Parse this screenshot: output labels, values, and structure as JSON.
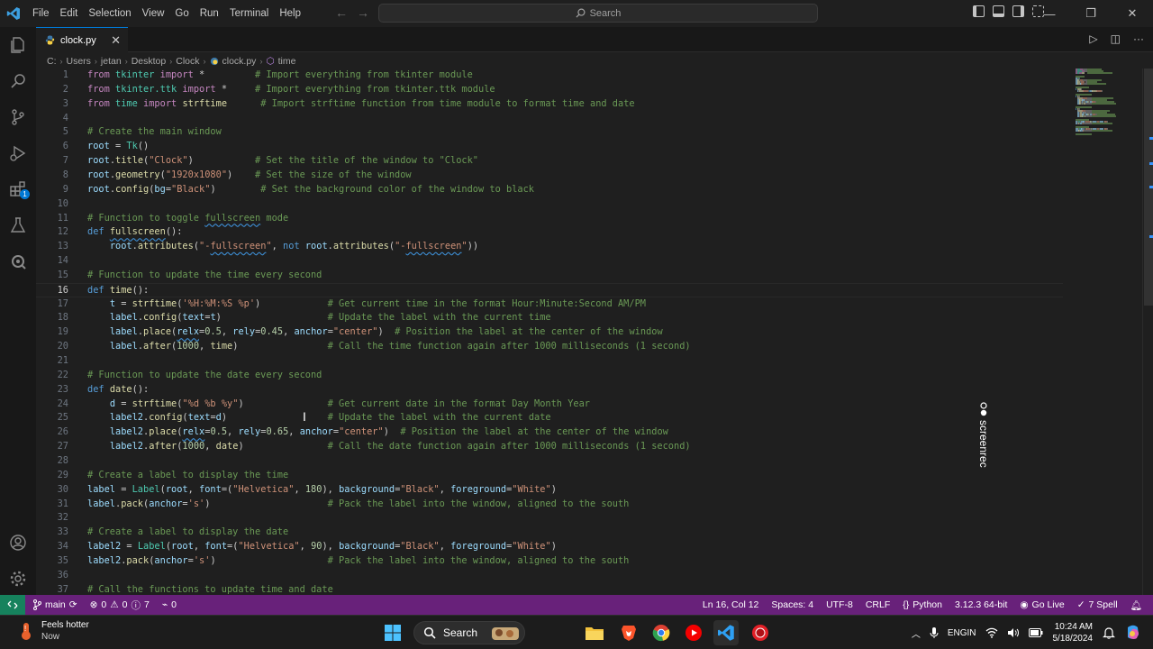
{
  "menu": [
    "File",
    "Edit",
    "Selection",
    "View",
    "Go",
    "Run",
    "Terminal",
    "Help"
  ],
  "search": {
    "placeholder": "Search"
  },
  "tab": {
    "name": "clock.py"
  },
  "breadcrumb": [
    "C:",
    "Users",
    "jetan",
    "Desktop",
    "Clock",
    "clock.py",
    "time"
  ],
  "editor": {
    "active_line": 16,
    "lines": [
      [
        [
          "kw2",
          "from"
        ],
        [
          "",
          " "
        ],
        [
          "cls",
          "tkinter"
        ],
        [
          "",
          " "
        ],
        [
          "kw2",
          "import"
        ],
        [
          "",
          " *         "
        ],
        [
          "cm",
          "# Import everything from tkinter module"
        ]
      ],
      [
        [
          "kw2",
          "from"
        ],
        [
          "",
          " "
        ],
        [
          "cls",
          "tkinter.ttk"
        ],
        [
          "",
          " "
        ],
        [
          "kw2",
          "import"
        ],
        [
          "",
          " *     "
        ],
        [
          "cm",
          "# Import everything from tkinter.ttk module"
        ]
      ],
      [
        [
          "kw2",
          "from"
        ],
        [
          "",
          " "
        ],
        [
          "cls",
          "time"
        ],
        [
          "",
          " "
        ],
        [
          "kw2",
          "import"
        ],
        [
          "",
          " "
        ],
        [
          "fn",
          "strftime"
        ],
        [
          "",
          "      "
        ],
        [
          "cm",
          "# Import strftime function from time module to format time and date"
        ]
      ],
      [],
      [
        [
          "cm",
          "# Create the main window"
        ]
      ],
      [
        [
          "var",
          "root"
        ],
        [
          "",
          " = "
        ],
        [
          "cls",
          "Tk"
        ],
        [
          "",
          "()"
        ]
      ],
      [
        [
          "var",
          "root"
        ],
        [
          "",
          "."
        ],
        [
          "fn",
          "title"
        ],
        [
          "",
          "("
        ],
        [
          "str",
          "\"Clock\""
        ],
        [
          "",
          ")           "
        ],
        [
          "cm",
          "# Set the title of the window to \"Clock\""
        ]
      ],
      [
        [
          "var",
          "root"
        ],
        [
          "",
          "."
        ],
        [
          "fn",
          "geometry"
        ],
        [
          "",
          "("
        ],
        [
          "str",
          "\"1920x1080\""
        ],
        [
          "",
          ")    "
        ],
        [
          "cm",
          "# Set the size of the window"
        ]
      ],
      [
        [
          "var",
          "root"
        ],
        [
          "",
          "."
        ],
        [
          "fn",
          "config"
        ],
        [
          "",
          "("
        ],
        [
          "var",
          "bg"
        ],
        [
          "",
          "="
        ],
        [
          "str",
          "\"Black\""
        ],
        [
          "",
          ")        "
        ],
        [
          "cm",
          "# Set the background color of the window to black"
        ]
      ],
      [],
      [
        [
          "cm",
          "# Function to toggle "
        ],
        [
          "cm sq",
          "fullscreen"
        ],
        [
          "cm",
          " mode"
        ]
      ],
      [
        [
          "kw",
          "def"
        ],
        [
          "",
          " "
        ],
        [
          "fn sq",
          "fullscreen"
        ],
        [
          "",
          "():"
        ]
      ],
      [
        [
          "",
          "    "
        ],
        [
          "var",
          "root"
        ],
        [
          "",
          "."
        ],
        [
          "fn",
          "attributes"
        ],
        [
          "",
          "("
        ],
        [
          "str",
          "\"-"
        ],
        [
          "str sq",
          "fullscreen"
        ],
        [
          "str",
          "\""
        ],
        [
          "",
          ", "
        ],
        [
          "kw",
          "not"
        ],
        [
          "",
          " "
        ],
        [
          "var",
          "root"
        ],
        [
          "",
          "."
        ],
        [
          "fn",
          "attributes"
        ],
        [
          "",
          "("
        ],
        [
          "str",
          "\"-"
        ],
        [
          "str sq",
          "fullscreen"
        ],
        [
          "str",
          "\""
        ],
        [
          "",
          "))"
        ]
      ],
      [],
      [
        [
          "cm",
          "# Function to update the time every second"
        ]
      ],
      [
        [
          "kw",
          "def"
        ],
        [
          "",
          " "
        ],
        [
          "fn",
          "time"
        ],
        [
          "",
          "():"
        ]
      ],
      [
        [
          "",
          "    "
        ],
        [
          "var",
          "t"
        ],
        [
          "",
          " = "
        ],
        [
          "fn",
          "strftime"
        ],
        [
          "",
          "("
        ],
        [
          "str",
          "'%H:%M:%S %p'"
        ],
        [
          "",
          ")            "
        ],
        [
          "cm",
          "# Get current time in the format Hour:Minute:Second AM/PM"
        ]
      ],
      [
        [
          "",
          "    "
        ],
        [
          "var",
          "label"
        ],
        [
          "",
          "."
        ],
        [
          "fn",
          "config"
        ],
        [
          "",
          "("
        ],
        [
          "var",
          "text"
        ],
        [
          "",
          "="
        ],
        [
          "var",
          "t"
        ],
        [
          "",
          ")                   "
        ],
        [
          "cm",
          "# Update the label with the current time"
        ]
      ],
      [
        [
          "",
          "    "
        ],
        [
          "var",
          "label"
        ],
        [
          "",
          "."
        ],
        [
          "fn",
          "place"
        ],
        [
          "",
          "("
        ],
        [
          "var sq",
          "relx"
        ],
        [
          "",
          "="
        ],
        [
          "num",
          "0.5"
        ],
        [
          "",
          ", "
        ],
        [
          "var",
          "rely"
        ],
        [
          "",
          "="
        ],
        [
          "num",
          "0.45"
        ],
        [
          "",
          ", "
        ],
        [
          "var",
          "anchor"
        ],
        [
          "",
          "="
        ],
        [
          "str",
          "\"center\""
        ],
        [
          "",
          ")  "
        ],
        [
          "cm",
          "# Position the label at the center of the window"
        ]
      ],
      [
        [
          "",
          "    "
        ],
        [
          "var",
          "label"
        ],
        [
          "",
          "."
        ],
        [
          "fn",
          "after"
        ],
        [
          "",
          "("
        ],
        [
          "num",
          "1000"
        ],
        [
          "",
          ", "
        ],
        [
          "fn",
          "time"
        ],
        [
          "",
          ")                "
        ],
        [
          "cm",
          "# Call the time function again after 1000 milliseconds (1 second)"
        ]
      ],
      [],
      [
        [
          "cm",
          "# Function to update the date every second"
        ]
      ],
      [
        [
          "kw",
          "def"
        ],
        [
          "",
          " "
        ],
        [
          "fn",
          "date"
        ],
        [
          "",
          "():"
        ]
      ],
      [
        [
          "",
          "    "
        ],
        [
          "var",
          "d"
        ],
        [
          "",
          " = "
        ],
        [
          "fn",
          "strftime"
        ],
        [
          "",
          "("
        ],
        [
          "str",
          "\"%d %b %y\""
        ],
        [
          "",
          ")               "
        ],
        [
          "cm",
          "# Get current date in the format Day Month Year"
        ]
      ],
      [
        [
          "",
          "    "
        ],
        [
          "var",
          "label2"
        ],
        [
          "",
          "."
        ],
        [
          "fn",
          "config"
        ],
        [
          "",
          "("
        ],
        [
          "var",
          "text"
        ],
        [
          "",
          "="
        ],
        [
          "var",
          "d"
        ],
        [
          "",
          ")                  "
        ],
        [
          "cm",
          "# Update the label with the current date"
        ]
      ],
      [
        [
          "",
          "    "
        ],
        [
          "var",
          "label2"
        ],
        [
          "",
          "."
        ],
        [
          "fn",
          "place"
        ],
        [
          "",
          "("
        ],
        [
          "var sq",
          "relx"
        ],
        [
          "",
          "="
        ],
        [
          "num",
          "0.5"
        ],
        [
          "",
          ", "
        ],
        [
          "var",
          "rely"
        ],
        [
          "",
          "="
        ],
        [
          "num",
          "0.65"
        ],
        [
          "",
          ", "
        ],
        [
          "var",
          "anchor"
        ],
        [
          "",
          "="
        ],
        [
          "str",
          "\"center\""
        ],
        [
          "",
          ")  "
        ],
        [
          "cm",
          "# Position the label at the center of the window"
        ]
      ],
      [
        [
          "",
          "    "
        ],
        [
          "var",
          "label2"
        ],
        [
          "",
          "."
        ],
        [
          "fn",
          "after"
        ],
        [
          "",
          "("
        ],
        [
          "num",
          "1000"
        ],
        [
          "",
          ", "
        ],
        [
          "fn",
          "date"
        ],
        [
          "",
          ")               "
        ],
        [
          "cm",
          "# Call the date function again after 1000 milliseconds (1 second)"
        ]
      ],
      [],
      [
        [
          "cm",
          "# Create a label to display the time"
        ]
      ],
      [
        [
          "var",
          "label"
        ],
        [
          "",
          " = "
        ],
        [
          "cls",
          "Label"
        ],
        [
          "",
          "("
        ],
        [
          "var",
          "root"
        ],
        [
          "",
          ", "
        ],
        [
          "var",
          "font"
        ],
        [
          "",
          "=("
        ],
        [
          "str",
          "\"Helvetica\""
        ],
        [
          "",
          ", "
        ],
        [
          "num",
          "180"
        ],
        [
          "",
          "), "
        ],
        [
          "var",
          "background"
        ],
        [
          "",
          "="
        ],
        [
          "str",
          "\"Black\""
        ],
        [
          "",
          ", "
        ],
        [
          "var",
          "foreground"
        ],
        [
          "",
          "="
        ],
        [
          "str",
          "\"White\""
        ],
        [
          "",
          ")"
        ]
      ],
      [
        [
          "var",
          "label"
        ],
        [
          "",
          "."
        ],
        [
          "fn",
          "pack"
        ],
        [
          "",
          "("
        ],
        [
          "var",
          "anchor"
        ],
        [
          "",
          "="
        ],
        [
          "str",
          "'s'"
        ],
        [
          "",
          ")                     "
        ],
        [
          "cm",
          "# Pack the label into the window, aligned to the south"
        ]
      ],
      [],
      [
        [
          "cm",
          "# Create a label to display the date"
        ]
      ],
      [
        [
          "var",
          "label2"
        ],
        [
          "",
          " = "
        ],
        [
          "cls",
          "Label"
        ],
        [
          "",
          "("
        ],
        [
          "var",
          "root"
        ],
        [
          "",
          ", "
        ],
        [
          "var",
          "font"
        ],
        [
          "",
          "=("
        ],
        [
          "str",
          "\"Helvetica\""
        ],
        [
          "",
          ", "
        ],
        [
          "num",
          "90"
        ],
        [
          "",
          "), "
        ],
        [
          "var",
          "background"
        ],
        [
          "",
          "="
        ],
        [
          "str",
          "\"Black\""
        ],
        [
          "",
          ", "
        ],
        [
          "var",
          "foreground"
        ],
        [
          "",
          "="
        ],
        [
          "str",
          "\"White\""
        ],
        [
          "",
          ")"
        ]
      ],
      [
        [
          "var",
          "label2"
        ],
        [
          "",
          "."
        ],
        [
          "fn",
          "pack"
        ],
        [
          "",
          "("
        ],
        [
          "var",
          "anchor"
        ],
        [
          "",
          "="
        ],
        [
          "str",
          "'s'"
        ],
        [
          "",
          ")                    "
        ],
        [
          "cm",
          "# Pack the label into the window, aligned to the south"
        ]
      ],
      [],
      [
        [
          "cm",
          "# Call the functions to update time and date"
        ]
      ]
    ]
  },
  "watermark": "screenrec",
  "statusbar": {
    "branch": "main",
    "errors": "0",
    "warnings": "0",
    "info": "7",
    "ports": "0",
    "position": "Ln 16, Col 12",
    "spaces": "Spaces: 4",
    "encoding": "UTF-8",
    "eol": "CRLF",
    "language": "Python",
    "interpreter": "3.12.3 64-bit",
    "golive": "Go Live",
    "spell": "7 Spell"
  },
  "taskbar": {
    "weather_title": "Feels hotter",
    "weather_sub": "Now",
    "search_label": "Search",
    "lang_top": "ENG",
    "lang_bottom": "IN",
    "time": "10:24 AM",
    "date": "5/18/2024"
  },
  "colors": {
    "statusbar": "#68217a",
    "accent": "#0078d4",
    "remote": "#16825d"
  }
}
